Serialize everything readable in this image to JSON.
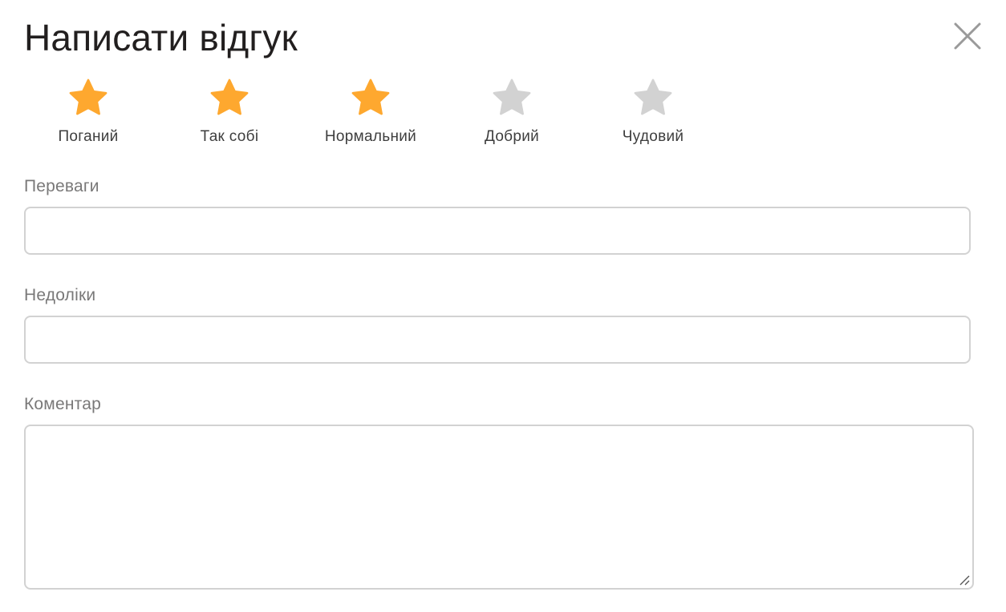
{
  "dialog": {
    "title": "Написати відгук",
    "close_icon": "close-icon"
  },
  "rating": {
    "value": 3,
    "max": 5,
    "active_color": "#fea82f",
    "inactive_color": "#d2d2d2",
    "items": [
      {
        "label": "Поганий",
        "icon": "star-icon",
        "filled": true
      },
      {
        "label": "Так собі",
        "icon": "star-icon",
        "filled": true
      },
      {
        "label": "Нормальний",
        "icon": "star-icon",
        "filled": true
      },
      {
        "label": "Добрий",
        "icon": "star-icon",
        "filled": false
      },
      {
        "label": "Чудовий",
        "icon": "star-icon",
        "filled": false
      }
    ]
  },
  "form": {
    "advantages": {
      "label": "Переваги",
      "value": "",
      "placeholder": ""
    },
    "disadvantages": {
      "label": "Недоліки",
      "value": "",
      "placeholder": ""
    },
    "comment": {
      "label": "Коментар",
      "value": "",
      "placeholder": ""
    }
  }
}
